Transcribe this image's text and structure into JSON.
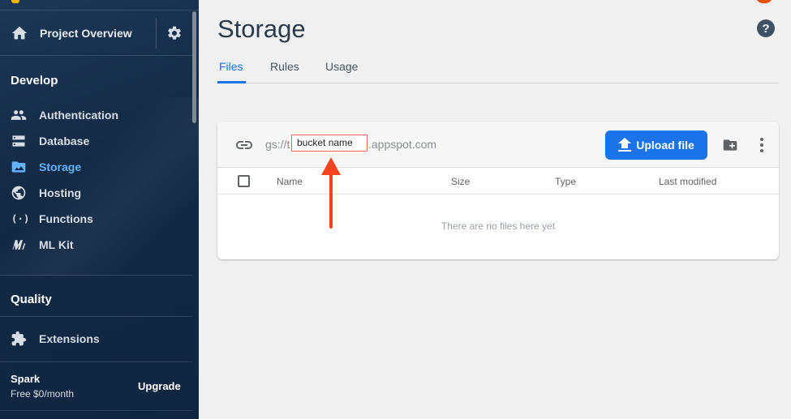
{
  "sidebar": {
    "project_label": "Project Overview",
    "sections": {
      "develop": "Develop",
      "quality": "Quality"
    },
    "items": [
      {
        "label": "Authentication",
        "icon": "people-icon"
      },
      {
        "label": "Database",
        "icon": "database-icon"
      },
      {
        "label": "Storage",
        "icon": "folder-image-icon",
        "active": true
      },
      {
        "label": "Hosting",
        "icon": "globe-icon"
      },
      {
        "label": "Functions",
        "icon": "functions-icon"
      },
      {
        "label": "ML Kit",
        "icon": "ml-kit-icon"
      }
    ],
    "extensions_label": "Extensions",
    "plan": {
      "name": "Spark",
      "price": "Free $0/month",
      "upgrade_label": "Upgrade"
    }
  },
  "main": {
    "title": "Storage",
    "tabs": [
      {
        "label": "Files",
        "active": true
      },
      {
        "label": "Rules"
      },
      {
        "label": "Usage"
      }
    ],
    "bucket": {
      "prefix": "gs://t",
      "highlight": "bucket name",
      "suffix": ".appspot.com"
    },
    "upload_label": "Upload file",
    "columns": [
      "Name",
      "Size",
      "Type",
      "Last modified"
    ],
    "empty_text": "There are no files here yet"
  },
  "colors": {
    "accent": "#1a73e8",
    "active_nav": "#63b3ff",
    "annotation": "#f4431f"
  }
}
